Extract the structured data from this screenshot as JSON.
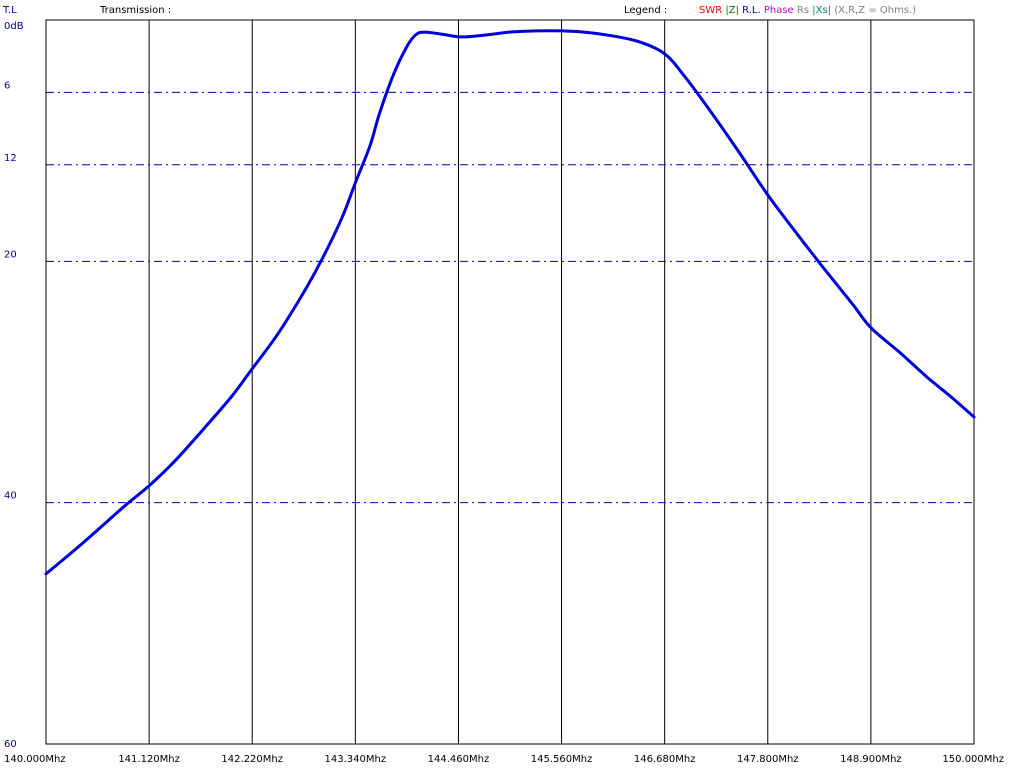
{
  "header": {
    "mode_label": "T.L",
    "title": "Transmission :",
    "legend_label": "Legend :",
    "legend": [
      {
        "text": "SWR",
        "color": "#ff0000"
      },
      {
        "text": "|Z|",
        "color": "#008000"
      },
      {
        "text": "R.L.",
        "color": "#0000b0"
      },
      {
        "text": "Phase",
        "color": "#c000c0"
      },
      {
        "text": "Rs",
        "color": "#808080"
      },
      {
        "text": "|Xs|",
        "color": "#008080"
      },
      {
        "text": "(X,R,Z = Ohms.)",
        "color": "#808080"
      }
    ]
  },
  "colors": {
    "trace": "#0000dd",
    "axis_text": "#0000a0",
    "gridline_h": "#0000cc",
    "gridline_v": "#000000"
  },
  "chart_data": {
    "type": "line",
    "title": "Transmission :",
    "xlabel": "",
    "ylabel": "",
    "xlim": [
      140.0,
      150.0
    ],
    "ylim": [
      0,
      60
    ],
    "y_inverted": true,
    "x_ticks": [
      {
        "value": 140.0,
        "label": "140.000Mhz"
      },
      {
        "value": 141.12,
        "label": "141.120Mhz"
      },
      {
        "value": 142.22,
        "label": "142.220Mhz"
      },
      {
        "value": 143.34,
        "label": "143.340Mhz"
      },
      {
        "value": 144.46,
        "label": "144.460Mhz"
      },
      {
        "value": 145.56,
        "label": "145.560Mhz"
      },
      {
        "value": 146.68,
        "label": "146.680Mhz"
      },
      {
        "value": 147.8,
        "label": "147.800Mhz"
      },
      {
        "value": 148.9,
        "label": "148.900Mhz"
      },
      {
        "value": 150.0,
        "label": "150.000Mhz"
      }
    ],
    "y_ticks": [
      {
        "value": 0,
        "label": "0dB"
      },
      {
        "value": 6,
        "label": "6"
      },
      {
        "value": 12,
        "label": "12"
      },
      {
        "value": 20,
        "label": "20"
      },
      {
        "value": 40,
        "label": "40"
      },
      {
        "value": 60,
        "label": "60"
      }
    ],
    "grid": {
      "vertical": true,
      "horizontal": true,
      "horizontal_style": "dash-dot"
    },
    "series": [
      {
        "values": [
          [
            140.0,
            45.9
          ],
          [
            140.3,
            44.0
          ],
          [
            140.6,
            42.0
          ],
          [
            140.85,
            40.3
          ],
          [
            141.12,
            38.6
          ],
          [
            141.4,
            36.5
          ],
          [
            141.7,
            33.9
          ],
          [
            142.0,
            31.2
          ],
          [
            142.22,
            28.9
          ],
          [
            142.5,
            26.0
          ],
          [
            142.8,
            22.3
          ],
          [
            143.0,
            19.5
          ],
          [
            143.2,
            16.3
          ],
          [
            143.34,
            13.5
          ],
          [
            143.5,
            10.4
          ],
          [
            143.6,
            7.8
          ],
          [
            143.75,
            4.6
          ],
          [
            143.9,
            2.2
          ],
          [
            144.0,
            1.2
          ],
          [
            144.1,
            1.0
          ],
          [
            144.3,
            1.2
          ],
          [
            144.5,
            1.4
          ],
          [
            144.8,
            1.2
          ],
          [
            145.0,
            1.0
          ],
          [
            145.3,
            0.9
          ],
          [
            145.56,
            0.9
          ],
          [
            145.8,
            1.0
          ],
          [
            146.1,
            1.3
          ],
          [
            146.4,
            1.8
          ],
          [
            146.68,
            2.8
          ],
          [
            146.9,
            4.7
          ],
          [
            147.2,
            7.8
          ],
          [
            147.5,
            11.1
          ],
          [
            147.8,
            14.5
          ],
          [
            148.1,
            17.6
          ],
          [
            148.4,
            20.6
          ],
          [
            148.7,
            23.5
          ],
          [
            148.9,
            25.5
          ],
          [
            149.2,
            27.5
          ],
          [
            149.5,
            29.6
          ],
          [
            149.75,
            31.2
          ],
          [
            150.0,
            32.9
          ]
        ]
      }
    ]
  }
}
